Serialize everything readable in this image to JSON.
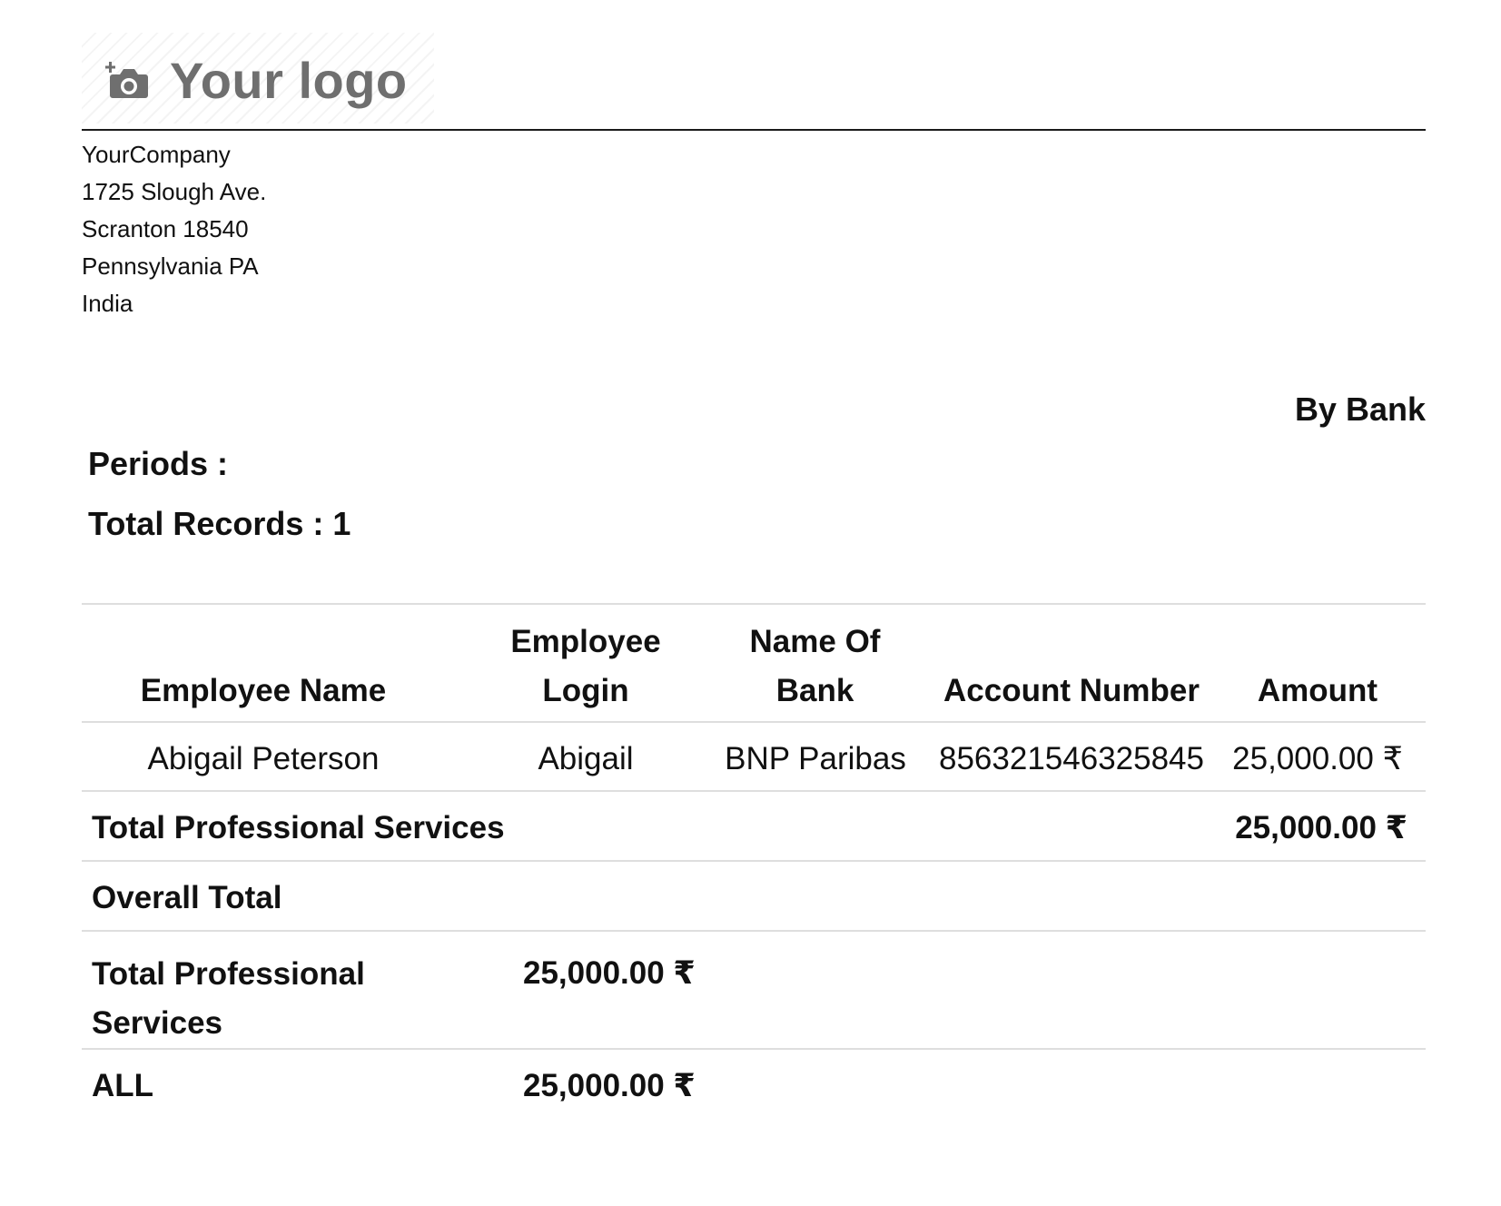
{
  "header": {
    "logo_text": "Your logo",
    "company": {
      "name": "YourCompany",
      "street": "1725 Slough Ave.",
      "city_zip": "Scranton 18540",
      "state": "Pennsylvania PA",
      "country": "India"
    }
  },
  "report": {
    "group_by": "By Bank",
    "periods_label": "Periods :",
    "total_records_label": "Total Records :",
    "total_records_value": "1"
  },
  "table": {
    "columns": {
      "employee_name": "Employee Name",
      "employee_login_1": "Employee",
      "employee_login_2": "Login",
      "bank_name_1": "Name Of",
      "bank_name_2": "Bank",
      "account_number": "Account Number",
      "amount": "Amount"
    },
    "rows": [
      {
        "employee_name": "Abigail Peterson",
        "employee_login": "Abigail",
        "bank_name": "BNP Paribas",
        "account_number": "856321546325845",
        "amount": "25,000.00 ₹"
      }
    ],
    "subtotal": {
      "label": "Total Professional Services",
      "amount": "25,000.00 ₹"
    },
    "overall_title": "Overall Total",
    "overall_rows": [
      {
        "label_line1": "Total Professional",
        "label_line2": "Services",
        "amount": "25,000.00 ₹"
      },
      {
        "label": "ALL",
        "amount": "25,000.00 ₹"
      }
    ]
  }
}
